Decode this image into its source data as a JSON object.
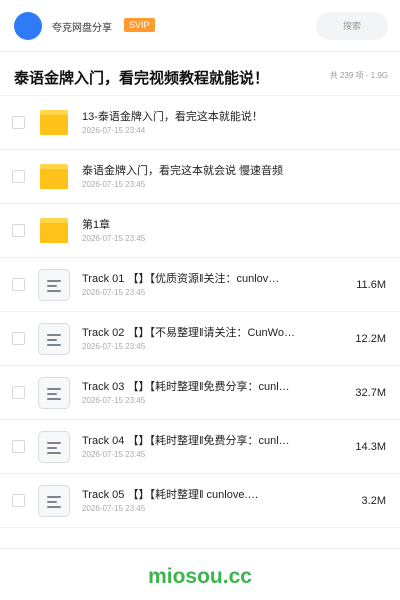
{
  "header": {
    "share_name": "夸克网盘分享",
    "badge": "SVIP",
    "search_placeholder": "搜索"
  },
  "title_bar": {
    "title": "泰语金牌入门，看完视频教程就能说！",
    "summary": "共 239 项 · 1.9G"
  },
  "items": [
    {
      "type": "folder",
      "name": "13-泰语金牌入门，看完这本就能说！",
      "date": "2026-07-15 23:44",
      "size": ""
    },
    {
      "type": "folder",
      "name": "泰语金牌入门，看完这本就会说 慢速音频",
      "date": "2026-07-15 23:45",
      "size": ""
    },
    {
      "type": "folder",
      "name": "第1章",
      "date": "2026-07-15 23:45",
      "size": ""
    },
    {
      "type": "file",
      "name": "Track 01 【】【优质资源‖关注：cunlov…",
      "date": "2026-07-15 23:45",
      "size": "11.6M"
    },
    {
      "type": "file",
      "name": "Track 02 【】【不易整理‖请关注：CunWo…",
      "date": "2026-07-15 23:45",
      "size": "12.2M"
    },
    {
      "type": "file",
      "name": "Track 03 【】【耗时整理‖免费分享：cunl…",
      "date": "2026-07-15 23:45",
      "size": "32.7M"
    },
    {
      "type": "file",
      "name": "Track 04 【】【耗时整理‖免费分享：cunl…",
      "date": "2026-07-15 23:45",
      "size": "14.3M"
    },
    {
      "type": "file",
      "name": "Track 05 【】【耗时整理‖ cunlove.…",
      "date": "2026-07-15 23:45",
      "size": "3.2M"
    }
  ],
  "footer": {
    "brand": "miosou.cc"
  },
  "colors": {
    "avatar": "#2f7bf6",
    "svip": "#ff9a2e",
    "folder": "#ffc21a",
    "brand": "#3ab54a"
  }
}
